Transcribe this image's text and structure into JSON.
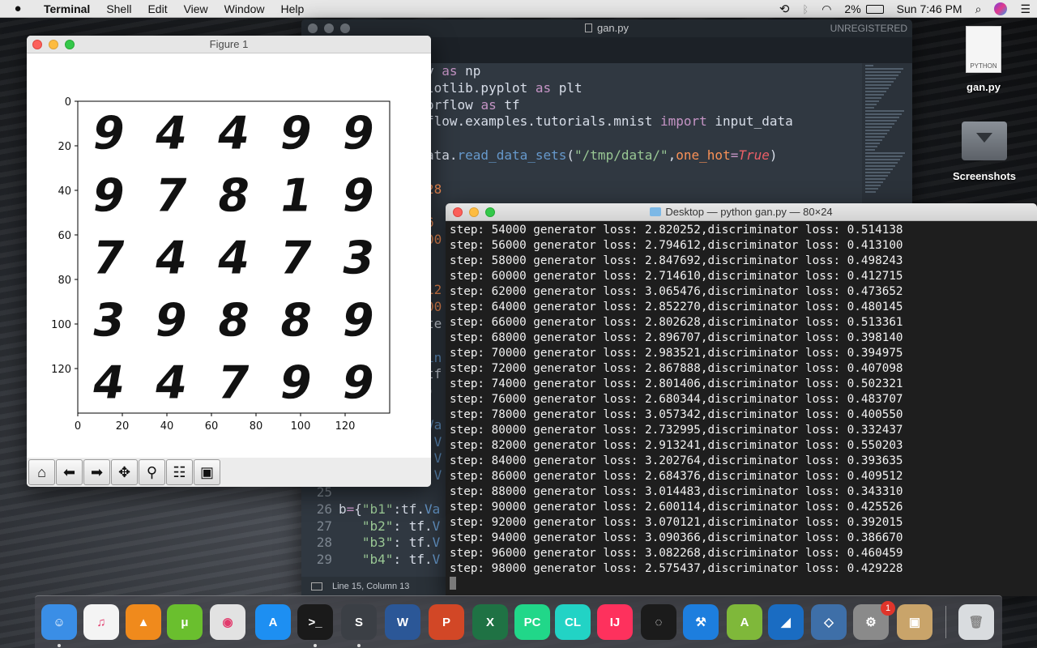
{
  "menubar": {
    "app": "Terminal",
    "items": [
      "Shell",
      "Edit",
      "View",
      "Window",
      "Help"
    ],
    "battery": "2%",
    "clock": "Sun 7:46 PM"
  },
  "desktop": {
    "icons": [
      {
        "label": "gan.py",
        "badge": "PYTHON"
      },
      {
        "label": "Screenshots"
      }
    ]
  },
  "sublime": {
    "title": "gan.py",
    "unregistered": "UNREGISTERED",
    "status": "Line 15, Column 13",
    "lines_top": [
      {
        "segs": [
          [
            "y ",
            ""
          ],
          [
            "as",
            "k"
          ],
          [
            " np",
            ""
          ]
        ]
      },
      {
        "segs": [
          [
            "lotlib.pyplot ",
            ""
          ],
          [
            "as",
            "k"
          ],
          [
            " plt",
            ""
          ]
        ]
      },
      {
        "segs": [
          [
            "orflow ",
            ""
          ],
          [
            "as",
            "k"
          ],
          [
            " tf",
            ""
          ]
        ]
      },
      {
        "segs": [
          [
            "flow.examples.tutorials.mnist ",
            ""
          ],
          [
            "import",
            "k"
          ],
          [
            " input_data",
            ""
          ]
        ]
      },
      {
        "segs": [
          [
            "",
            ""
          ]
        ]
      },
      {
        "segs": [
          [
            "ata.",
            ""
          ],
          [
            "read_data_sets",
            "f"
          ],
          [
            "(",
            ""
          ],
          [
            "\"/tmp/data/\"",
            "s"
          ],
          [
            ",",
            ""
          ],
          [
            "one_hot",
            "n"
          ],
          [
            "=",
            "k"
          ],
          [
            "True",
            "t"
          ],
          [
            ")",
            ""
          ]
        ]
      },
      {
        "segs": [
          [
            "",
            ""
          ]
        ]
      },
      {
        "segs": [
          [
            "28",
            "n"
          ]
        ]
      },
      {
        "segs": [
          [
            "",
            ""
          ]
        ]
      },
      {
        "segs": [
          [
            "6",
            "n"
          ]
        ]
      },
      {
        "segs": [
          [
            "00",
            "n"
          ]
        ]
      },
      {
        "segs": [
          [
            "",
            ""
          ]
        ]
      },
      {
        "segs": [
          [
            "",
            ""
          ]
        ]
      },
      {
        "segs": [
          [
            "12",
            "n"
          ]
        ]
      },
      {
        "segs": [
          [
            "00",
            "n"
          ]
        ]
      },
      {
        "segs": [
          [
            "te",
            ""
          ]
        ]
      },
      {
        "segs": [
          [
            "",
            ""
          ]
        ]
      },
      {
        "segs": [
          [
            "in",
            "f"
          ]
        ]
      },
      {
        "segs": [
          [
            "tf",
            ""
          ]
        ]
      },
      {
        "segs": [
          [
            ")",
            ""
          ]
        ]
      },
      {
        "segs": [
          [
            "",
            ""
          ]
        ]
      },
      {
        "segs": [
          [
            "Va",
            "f"
          ]
        ]
      },
      {
        "segs": [
          [
            ".V",
            "f"
          ]
        ]
      },
      {
        "segs": [
          [
            ".V",
            "f"
          ]
        ]
      },
      {
        "segs": [
          [
            ".V",
            "f"
          ]
        ]
      }
    ],
    "numbered": [
      {
        "num": "25",
        "segs": [
          [
            "",
            ""
          ]
        ]
      },
      {
        "num": "26",
        "segs": [
          [
            "b",
            ""
          ],
          [
            "=",
            "k"
          ],
          [
            "{",
            ""
          ],
          [
            "\"b1\"",
            "s"
          ],
          [
            ":tf.",
            ""
          ],
          [
            "Va",
            "f"
          ]
        ]
      },
      {
        "num": "27",
        "segs": [
          [
            "   ",
            ""
          ],
          [
            "\"b2\"",
            "s"
          ],
          [
            ": tf.",
            ""
          ],
          [
            "V",
            "f"
          ]
        ]
      },
      {
        "num": "28",
        "segs": [
          [
            "   ",
            ""
          ],
          [
            "\"b3\"",
            "s"
          ],
          [
            ": tf.",
            ""
          ],
          [
            "V",
            "f"
          ]
        ]
      },
      {
        "num": "29",
        "segs": [
          [
            "   ",
            ""
          ],
          [
            "\"b4\"",
            "s"
          ],
          [
            ": tf.",
            ""
          ],
          [
            "V",
            "f"
          ]
        ]
      }
    ]
  },
  "figure": {
    "title": "Figure 1",
    "y_ticks": [
      "0",
      "20",
      "40",
      "60",
      "80",
      "100",
      "120"
    ],
    "x_ticks": [
      "0",
      "20",
      "40",
      "60",
      "80",
      "100",
      "120"
    ],
    "digits": [
      [
        "9",
        "4",
        "4",
        "9",
        "9"
      ],
      [
        "9",
        "7",
        "8",
        "1",
        "9"
      ],
      [
        "7",
        "4",
        "4",
        "7",
        "3"
      ],
      [
        "3",
        "9",
        "8",
        "8",
        "9"
      ],
      [
        "4",
        "4",
        "7",
        "9",
        "9"
      ]
    ],
    "toolbar": [
      "home-icon",
      "back-arrow-icon",
      "forward-arrow-icon",
      "pan-icon",
      "zoom-icon",
      "configure-icon",
      "save-icon"
    ]
  },
  "terminal": {
    "title": "Desktop — python gan.py — 80×24",
    "rows": [
      [
        "54000",
        "2.820252",
        "0.514138"
      ],
      [
        "56000",
        "2.794612",
        "0.413100"
      ],
      [
        "58000",
        "2.847692",
        "0.498243"
      ],
      [
        "60000",
        "2.714610",
        "0.412715"
      ],
      [
        "62000",
        "3.065476",
        "0.473652"
      ],
      [
        "64000",
        "2.852270",
        "0.480145"
      ],
      [
        "66000",
        "2.802628",
        "0.513361"
      ],
      [
        "68000",
        "2.896707",
        "0.398140"
      ],
      [
        "70000",
        "2.983521",
        "0.394975"
      ],
      [
        "72000",
        "2.867888",
        "0.407098"
      ],
      [
        "74000",
        "2.801406",
        "0.502321"
      ],
      [
        "76000",
        "2.680344",
        "0.483707"
      ],
      [
        "78000",
        "3.057342",
        "0.400550"
      ],
      [
        "80000",
        "2.732995",
        "0.332437"
      ],
      [
        "82000",
        "2.913241",
        "0.550203"
      ],
      [
        "84000",
        "3.202764",
        "0.393635"
      ],
      [
        "86000",
        "2.684376",
        "0.409512"
      ],
      [
        "88000",
        "3.014483",
        "0.343310"
      ],
      [
        "90000",
        "2.600114",
        "0.425526"
      ],
      [
        "92000",
        "3.070121",
        "0.392015"
      ],
      [
        "94000",
        "3.090366",
        "0.386670"
      ],
      [
        "96000",
        "3.082268",
        "0.460459"
      ],
      [
        "98000",
        "2.575437",
        "0.429228"
      ]
    ]
  },
  "dock": {
    "apps": [
      {
        "name": "finder",
        "color": "#3a8ee6",
        "glyph": "☺"
      },
      {
        "name": "itunes",
        "color": "#f4f4f4",
        "glyph": "♫"
      },
      {
        "name": "vlc",
        "color": "#f08a1c",
        "glyph": "▲"
      },
      {
        "name": "utorrent",
        "color": "#6abf2e",
        "glyph": "μ"
      },
      {
        "name": "chrome",
        "color": "#e2e2e2",
        "glyph": "◉"
      },
      {
        "name": "app-store",
        "color": "#1d8ff2",
        "glyph": "A"
      },
      {
        "name": "terminal",
        "color": "#1a1a1a",
        "glyph": ">_"
      },
      {
        "name": "sublime-text",
        "color": "#3b3f45",
        "glyph": "S"
      },
      {
        "name": "word",
        "color": "#2b5797",
        "glyph": "W"
      },
      {
        "name": "powerpoint",
        "color": "#d24726",
        "glyph": "P"
      },
      {
        "name": "excel",
        "color": "#1f7244",
        "glyph": "X"
      },
      {
        "name": "pycharm",
        "color": "#21d789",
        "glyph": "PC"
      },
      {
        "name": "clion",
        "color": "#22d3c5",
        "glyph": "CL"
      },
      {
        "name": "intellij",
        "color": "#fe315d",
        "glyph": "IJ"
      },
      {
        "name": "sync-app",
        "color": "#1b1b1b",
        "glyph": "◌"
      },
      {
        "name": "xcode",
        "color": "#1d7ede",
        "glyph": "⚒"
      },
      {
        "name": "android-studio",
        "color": "#7fb83a",
        "glyph": "A"
      },
      {
        "name": "wireshark",
        "color": "#1a6cc2",
        "glyph": "◢"
      },
      {
        "name": "virtualbox",
        "color": "#3e6fa8",
        "glyph": "◇"
      },
      {
        "name": "system-preferences",
        "color": "#8a8a8a",
        "glyph": "⚙",
        "badge": "1"
      },
      {
        "name": "preview",
        "color": "#c9a46a",
        "glyph": "▣"
      },
      {
        "name": "trash",
        "color": "#d9dcdf",
        "glyph": "🗑"
      }
    ]
  }
}
